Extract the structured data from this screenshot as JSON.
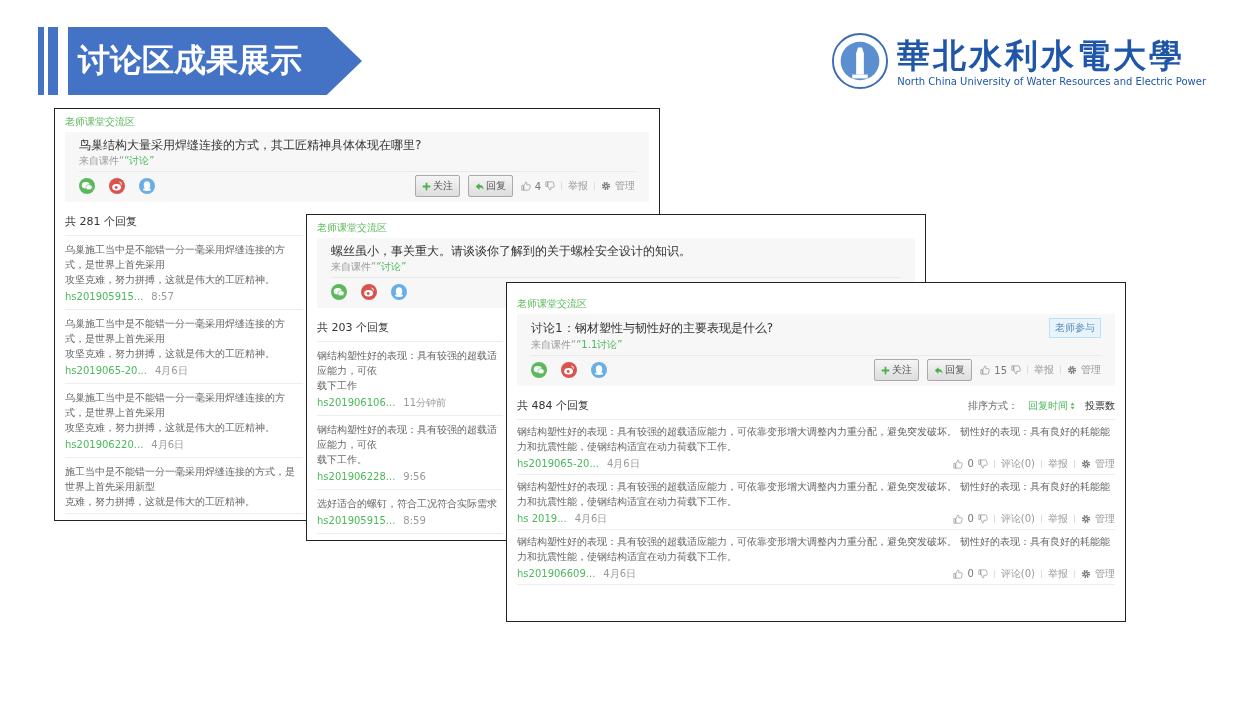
{
  "header": {
    "title": "讨论区成果展示"
  },
  "logo": {
    "name": "華北水利水電大學",
    "english": "North China University of Water Resources and Electric Power"
  },
  "screenshots": [
    {
      "section": "老师课堂交流区",
      "question": "鸟巢结构大量采用焊缝连接的方式，其工匠精神具体体现在哪里?",
      "source_prefix": "来自课件“",
      "source_link": "“讨论”",
      "buttons": [
        {
          "kind": "follow",
          "label": "关注"
        },
        {
          "kind": "reply",
          "label": "回复"
        }
      ],
      "likes": "4",
      "actions": [
        "举报",
        "管理"
      ],
      "reply_count": "共 281 个回复",
      "replies": [
        {
          "lines": [
            "乌巢施工当中是不能错一分一毫采用焊缝连接的方式，是世界上首先采用",
            "攻坚克难，努力拼搏，这就是伟大的工匠精神。"
          ],
          "user": "hs201905915...",
          "time": "8:57"
        },
        {
          "lines": [
            "乌巢施工当中是不能错一分一毫采用焊缝连接的方式，是世界上首先采用",
            "攻坚克难，努力拼搏，这就是伟大的工匠精神。"
          ],
          "user": "hs2019065-20...",
          "time": "4月6日"
        },
        {
          "lines": [
            "乌巢施工当中是不能错一分一毫采用焊缝连接的方式，是世界上首先采用",
            "攻坚克难，努力拼搏，这就是伟大的工匠精神。"
          ],
          "user": "hs201906220...",
          "time": "4月6日"
        },
        {
          "lines": [
            "施工当中是不能错一分一毫采用焊缝连接的方式，是世界上首先采用新型",
            "克难，努力拼搏，这就是伟大的工匠精神。"
          ]
        }
      ]
    },
    {
      "section": "老师课堂交流区",
      "question": "螺丝虽小，事关重大。请谈谈你了解到的关于螺栓安全设计的知识。",
      "source_prefix": "来自课件“",
      "source_link": "“讨论”",
      "reply_count": "共 203 个回复",
      "replies": [
        {
          "lines": [
            "钢结构塑性好的表现：具有较强的超载适应能力，可依",
            "载下工作"
          ],
          "user": "hs201906106...",
          "time": "11分钟前"
        },
        {
          "lines": [
            "钢结构塑性好的表现：具有较强的超载适应能力，可依",
            "载下工作。"
          ],
          "user": "hs201906228...",
          "time": "9:56"
        },
        {
          "lines": [
            "选好适合的螺钉，符合工况符合实际需求"
          ],
          "user": "hs201905915...",
          "time": "8:59"
        }
      ]
    },
    {
      "section": "老师课堂交流区",
      "question": "讨论1：钢材塑性与韧性好的主要表现是什么?",
      "tag": "老师参与",
      "source_prefix": "来自课件“",
      "source_link": "“1.1讨论”",
      "buttons": [
        {
          "kind": "follow",
          "label": "关注"
        },
        {
          "kind": "reply",
          "label": "回复"
        }
      ],
      "likes": "15",
      "actions": [
        "举报",
        "管理"
      ],
      "reply_count": "共 484 个回复",
      "sort": {
        "label": "排序方式：",
        "options": [
          {
            "label": "回复时间",
            "selected": true
          },
          {
            "label": "投票数",
            "selected": false
          }
        ]
      },
      "replies": [
        {
          "lines": [
            "钢结构塑性好的表现：具有较强的超载适应能力，可依靠变形增大调整内力重分配，避免突发破坏。 韧性好的表现：具有良好的耗能能力和抗震性能，使钢结构适宜在动力荷载下工作。"
          ],
          "user": "hs2019065-20...",
          "time": "4月6日",
          "likes": "0",
          "actions": [
            "评论(0)",
            "举报",
            "管理"
          ]
        },
        {
          "lines": [
            "钢结构塑性好的表现：具有较强的超载适应能力，可依靠变形增大调整内力重分配，避免突发破坏。 韧性好的表现：具有良好的耗能能力和抗震性能，使钢结构适宜在动力荷载下工作。"
          ],
          "user": "hs 2019...",
          "time": "4月6日",
          "likes": "0",
          "actions": [
            "评论(0)",
            "举报",
            "管理"
          ]
        },
        {
          "lines": [
            "钢结构塑性好的表现：具有较强的超载适应能力，可依靠变形增大调整内力重分配，避免突发破坏。 韧性好的表现：具有良好的耗能能力和抗震性能，使钢结构适宜在动力荷载下工作。"
          ],
          "user": "hs201906609...",
          "time": "4月6日",
          "likes": "0",
          "actions": [
            "评论(0)",
            "举报",
            "管理"
          ]
        }
      ]
    }
  ]
}
